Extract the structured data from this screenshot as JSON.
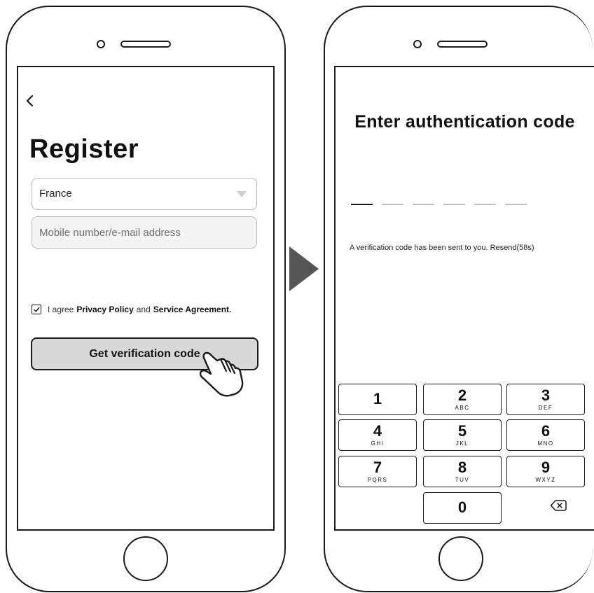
{
  "left_screen": {
    "title": "Register",
    "country": "France",
    "input_placeholder": "Mobile number/e-mail address",
    "agree": {
      "prefix": "I agree",
      "privacy_policy": "Privacy Policy",
      "and": "and",
      "service_agreement": "Service Agreement."
    },
    "button_label": "Get verification code",
    "icons": [
      "back-chevron-icon",
      "dropdown-arrow-icon",
      "checkbox-checked-icon",
      "pointing-hand-icon"
    ]
  },
  "transition_arrow": "next-arrow-icon",
  "right_screen": {
    "title": "Enter authentication code",
    "code_slots": 6,
    "message": "A verification code has been sent to you. Resend(58s)",
    "keypad": [
      {
        "num": "1",
        "letters": ""
      },
      {
        "num": "2",
        "letters": "ABC"
      },
      {
        "num": "3",
        "letters": "DEF"
      },
      {
        "num": "4",
        "letters": "GHI"
      },
      {
        "num": "5",
        "letters": "JKL"
      },
      {
        "num": "6",
        "letters": "MNO"
      },
      {
        "num": "7",
        "letters": "PQRS"
      },
      {
        "num": "8",
        "letters": "TUV"
      },
      {
        "num": "9",
        "letters": "WXYZ"
      },
      {
        "num": "0",
        "letters": ""
      }
    ],
    "delete_icon": "backspace-icon"
  },
  "colors": {
    "outline": "#1a1a1a",
    "button_fill": "#d8d8d8",
    "input_fill": "#f3f3f3",
    "arrow": "#555555"
  }
}
